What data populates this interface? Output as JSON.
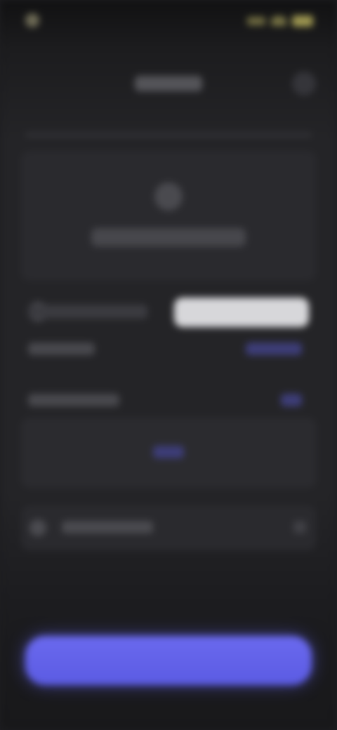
{
  "theme": {
    "background": "#1e1e21",
    "card": "#2a2a2e",
    "accent": "#5b5be3",
    "status_accent": "#c9c16a"
  },
  "status_bar": {
    "time": "",
    "icons": [
      "signal-icon",
      "wifi-icon",
      "battery-icon"
    ]
  },
  "header": {
    "title": "",
    "action_icon": "more-icon"
  },
  "upload": {
    "icon": "upload-icon",
    "label": ""
  },
  "options": {
    "pill_label": ""
  },
  "settings": [
    {
      "label": "",
      "value": ""
    },
    {
      "label": "",
      "value": ""
    }
  ],
  "inner_card": {
    "value": ""
  },
  "list_row": {
    "icon": "item-icon",
    "label": "",
    "trailing_icon": "chevron-right-icon"
  },
  "cta": {
    "label": ""
  }
}
